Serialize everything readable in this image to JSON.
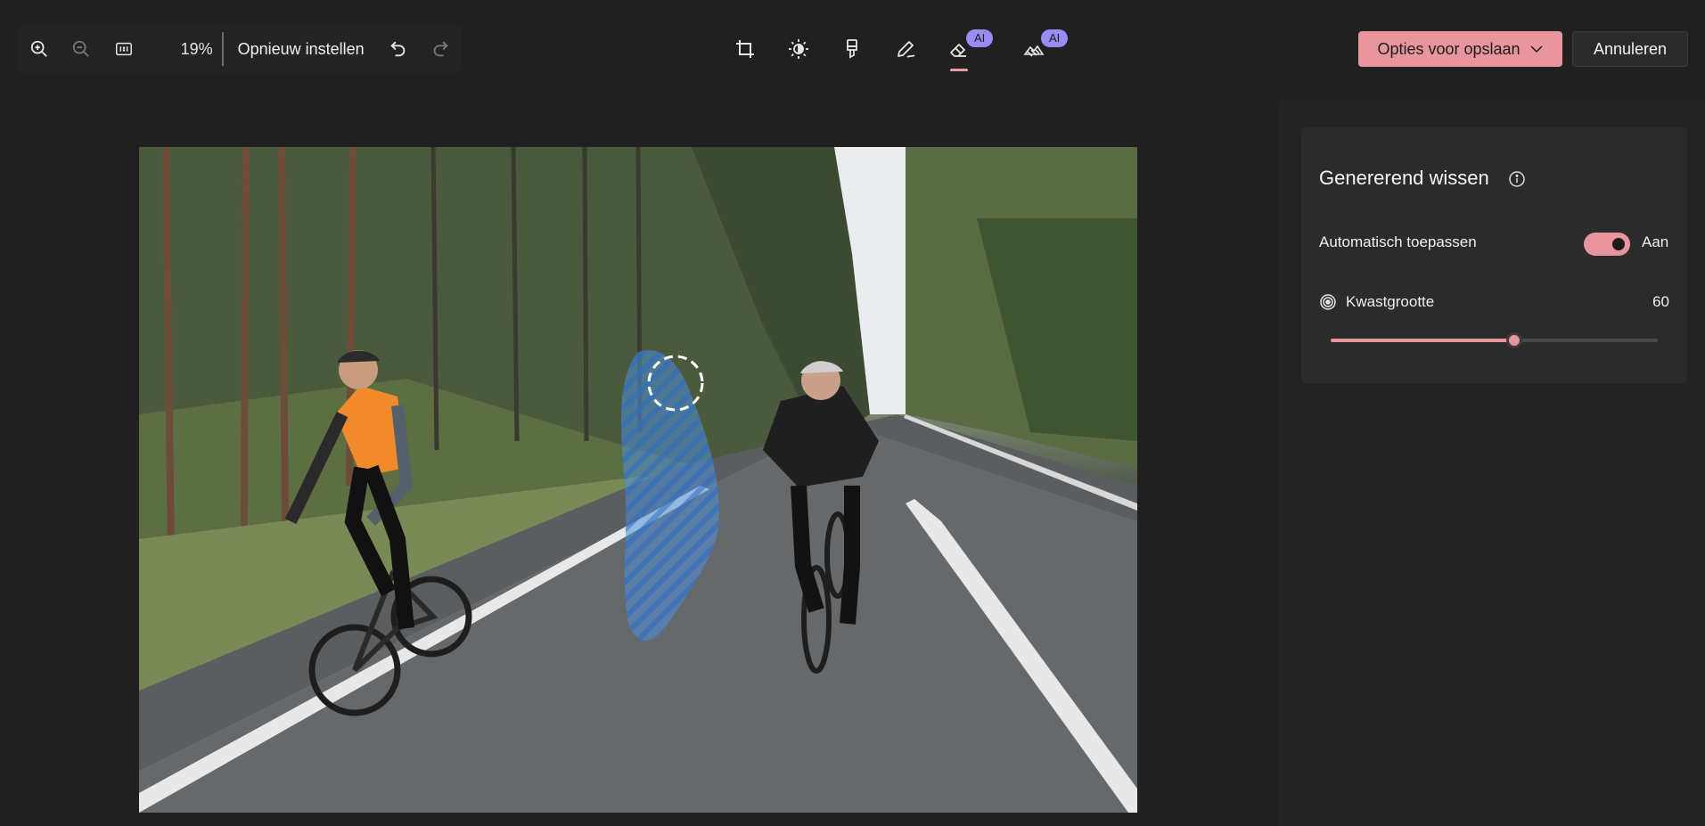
{
  "toolbar": {
    "zoom_level": "19%",
    "reset_label": "Opnieuw instellen",
    "icons": [
      "zoom-in-icon",
      "zoom-out-icon",
      "actual-size-icon",
      "undo-icon",
      "redo-icon"
    ]
  },
  "tools": [
    {
      "name": "crop-icon"
    },
    {
      "name": "brightness-icon"
    },
    {
      "name": "markup-icon"
    },
    {
      "name": "draw-icon"
    },
    {
      "name": "generative-erase-icon",
      "badge": "AI",
      "active": true
    },
    {
      "name": "background-icon",
      "badge": "AI"
    }
  ],
  "actions": {
    "save_label": "Opties voor opslaan",
    "cancel_label": "Annuleren"
  },
  "panel": {
    "title": "Genererend wissen",
    "auto_apply_label": "Automatisch toepassen",
    "auto_apply_state": "Aan",
    "brush_label": "Kwastgrootte",
    "brush_value": "60",
    "brush_fraction": 0.56
  },
  "colors": {
    "accent": "#e8959d",
    "ai_badge": "#9a8cf5",
    "background": "#202020"
  }
}
